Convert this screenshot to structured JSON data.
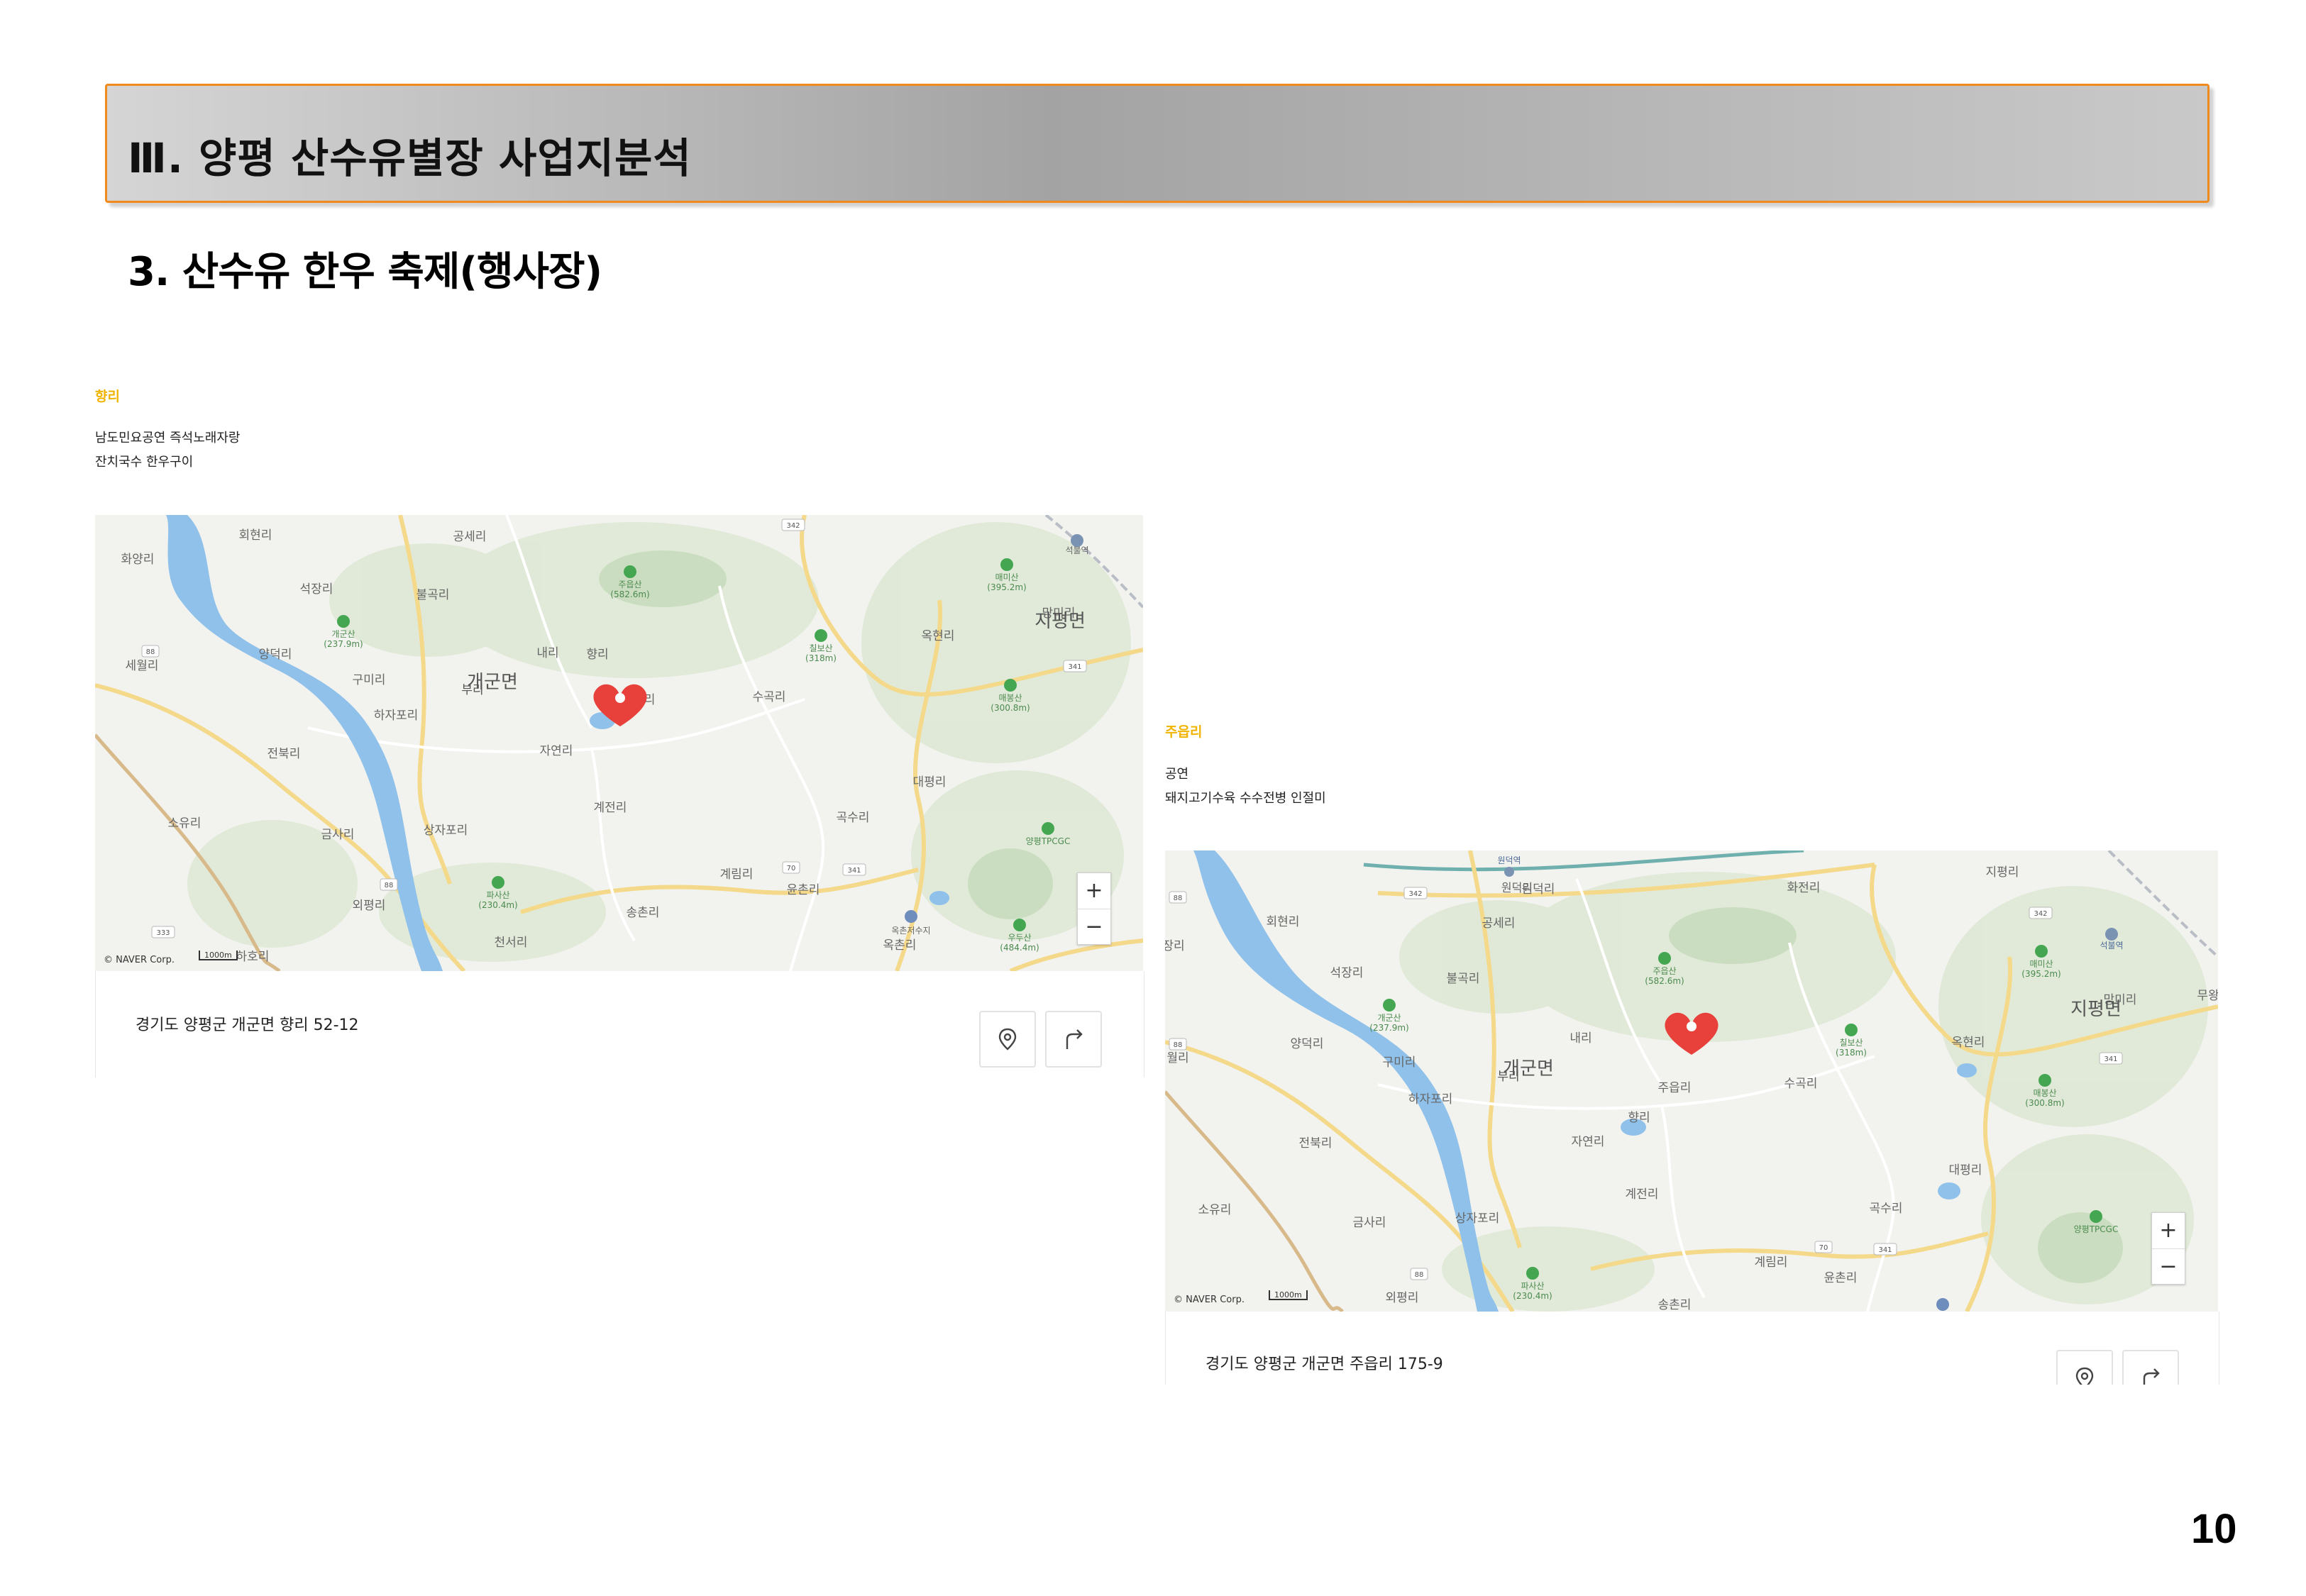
{
  "header": {
    "title": "Ⅲ. 양평 산수유별장 사업지분석"
  },
  "section": {
    "title": "3. 산수유 한우 축제(행사장)"
  },
  "cards": [
    {
      "place_name": "향리",
      "description": [
        "남도민요공연 즉석노래자랑",
        "잔치국수 한우구이"
      ],
      "address": "경기도 양평군 개군면 향리 52-12",
      "map": {
        "credit": "© NAVER Corp.",
        "scale": "1000m",
        "zoom_in": "+",
        "zoom_out": "−",
        "labels": {
          "l1": "회현리",
          "l2": "공세리",
          "l3": "화양리",
          "l4": "석장리",
          "l5": "불곡리",
          "l6": "주읍산",
          "l7": "(582.6m)",
          "l8": "개군산",
          "l9": "(237.9m)",
          "l10": "양덕리",
          "l11": "세월리",
          "l12": "구미리",
          "l13": "개군면",
          "l14": "부리",
          "l15": "내리",
          "l16": "칠보산",
          "l17": "(318m)",
          "l18": "주읍리",
          "l19": "향리",
          "l20": "하자포리",
          "l21": "자연리",
          "l22": "수곡리",
          "l23": "전북리",
          "l24": "계전리",
          "l25": "소유리",
          "l26": "금사리",
          "l27": "상자포리",
          "l28": "곡수리",
          "l29": "대평리",
          "l30": "외평리",
          "l31": "파사산",
          "l32": "(230.4m)",
          "l33": "송촌리",
          "l34": "계림리",
          "l35": "윤촌리",
          "l36": "천서리",
          "l37": "하호리",
          "l38": "옥촌리",
          "l39": "옥촌저수지",
          "l40": "지평면",
          "l41": "망미리",
          "l42": "옥현리",
          "l43": "매미산",
          "l44": "(395.2m)",
          "l45": "매봉산",
          "l46": "(300.8m)",
          "l47": "양평TPCGC",
          "l48": "우두산",
          "l49": "(484.4m)",
          "l50": "석불역",
          "r1": "342",
          "r2": "88",
          "r3": "341",
          "r4": "70",
          "r5": "341",
          "r6": "333",
          "r7": "88"
        }
      }
    },
    {
      "place_name": "주읍리",
      "description": [
        "공연",
        "돼지고기수육 수수전병 인절미"
      ],
      "address": "경기도 양평군 개군면 주읍리 175-9",
      "map": {
        "credit": "© NAVER Corp.",
        "scale": "1000m",
        "zoom_in": "+",
        "zoom_out": "−",
        "labels": {
          "l1": "원덕역",
          "l2": "원덕리",
          "l3": "화전리",
          "l4": "지평리",
          "l5": "회현리",
          "l6": "공세리",
          "l7": "장리",
          "l8": "석장리",
          "l9": "불곡리",
          "l10": "주읍산",
          "l11": "(582.6m)",
          "l12": "매미산",
          "l13": "(395.2m)",
          "l14": "석불역",
          "l15": "망미리",
          "l16": "지평면",
          "l17": "무왕",
          "l18": "개군산",
          "l19": "(237.9m)",
          "l20": "칠보산",
          "l21": "(318m)",
          "l22": "양덕리",
          "l23": "월리",
          "l24": "내리",
          "l25": "구미리",
          "l26": "개군면",
          "l27": "부리",
          "l28": "옥현리",
          "l29": "주읍리",
          "l30": "수곡리",
          "l31": "매봉산",
          "l32": "(300.8m)",
          "l33": "하자포리",
          "l34": "향리",
          "l35": "자연리",
          "l36": "전북리",
          "l37": "계전리",
          "l38": "대평리",
          "l39": "소유리",
          "l40": "금사리",
          "l41": "상자포리",
          "l42": "곡수리",
          "l43": "양평TPCGC",
          "l44": "계림리",
          "l45": "윤촌리",
          "l46": "외평리",
          "l47": "파사산",
          "l48": "(230.4m)",
          "l49": "송촌리",
          "r1": "342",
          "r2": "342",
          "r3": "88",
          "r4": "341",
          "r5": "88",
          "r6": "70",
          "r7": "341",
          "r8": "88"
        }
      }
    }
  ],
  "page_number": "10"
}
